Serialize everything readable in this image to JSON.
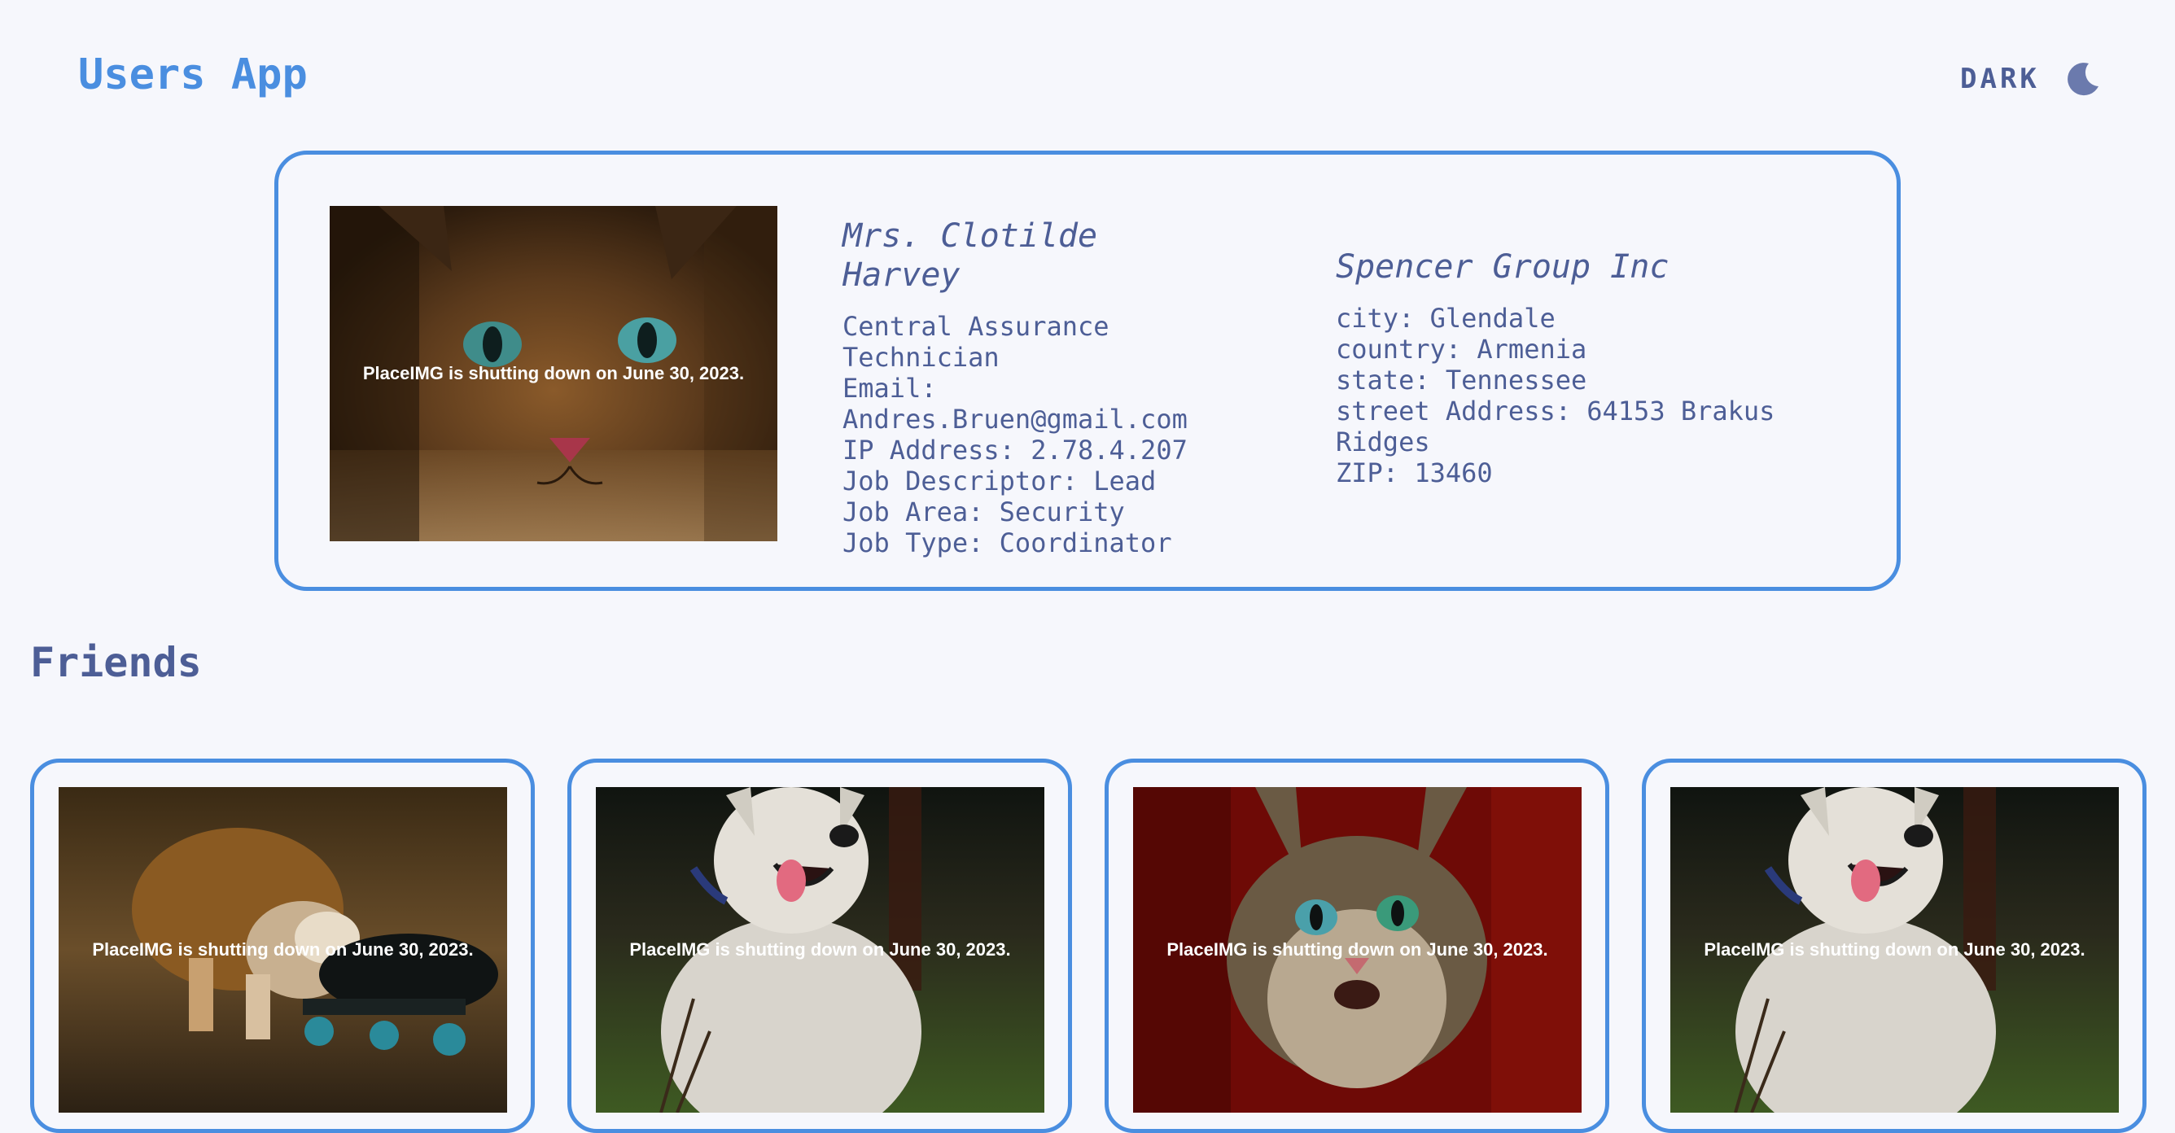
{
  "header": {
    "title": "Users App",
    "theme_label": "DARK",
    "theme_icon": "moon-icon"
  },
  "profile": {
    "photo_caption": "PlaceIMG is shutting down on June 30, 2023.",
    "name": "Mrs. Clotilde Harvey",
    "job_title_line1": "Central Assurance",
    "job_title_line2": "Technician",
    "email_label": "Email:",
    "email": "Andres.Bruen@gmail.com",
    "ip_address": "IP Address: 2.78.4.207",
    "job_descriptor": "Job Descriptor: Lead",
    "job_area": "Job Area: Security",
    "job_type": "Job Type: Coordinator",
    "company": "Spencer Group Inc",
    "city": "city: Glendale",
    "country": "country: Armenia",
    "state": "state: Tennessee",
    "street_line1": "street Address: 64153 Brakus",
    "street_line2": "Ridges",
    "zip": "ZIP: 13460"
  },
  "friends": {
    "title": "Friends",
    "cards": [
      {
        "caption": "PlaceIMG is shutting down on June 30, 2023."
      },
      {
        "caption": "PlaceIMG is shutting down on June 30, 2023."
      },
      {
        "caption": "PlaceIMG is shutting down on June 30, 2023."
      },
      {
        "caption": "PlaceIMG is shutting down on June 30, 2023."
      }
    ]
  },
  "colors": {
    "accent": "#4a8ee0",
    "text": "#4d5e96",
    "background": "#f6f7fc"
  }
}
